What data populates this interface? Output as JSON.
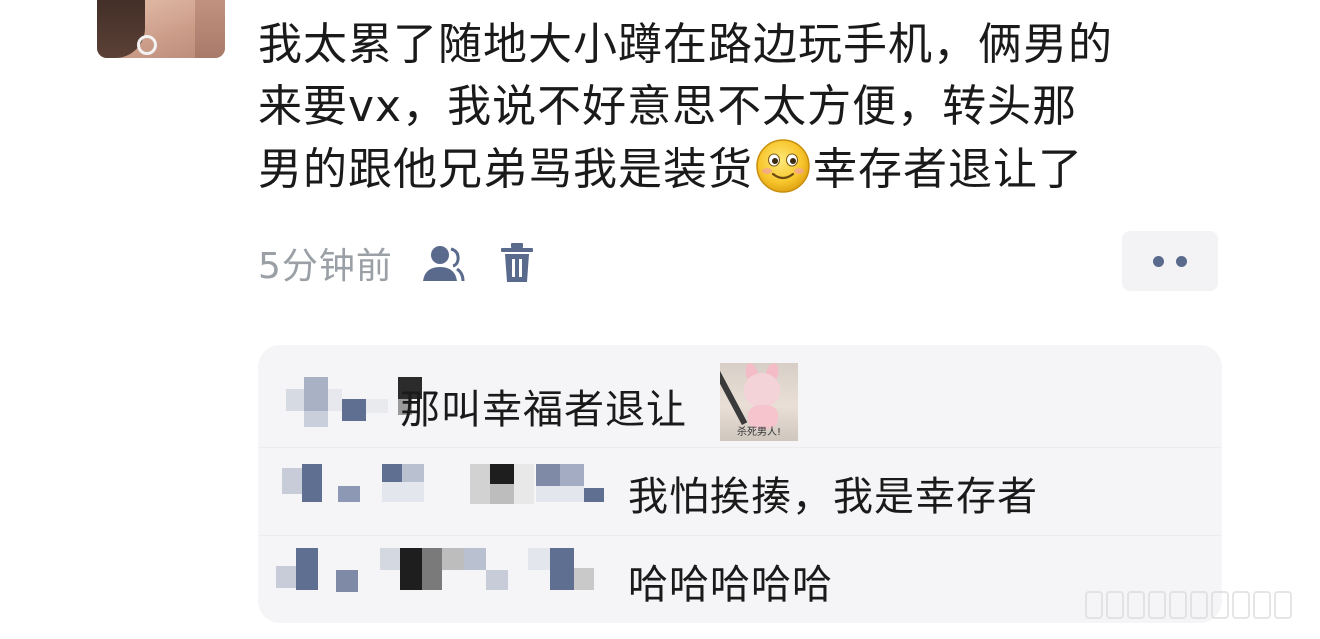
{
  "post": {
    "lines": [
      "我太累了随地大小蹲在路边玩手机，俩男的",
      "来要vx，我说不好意思不太方便，转头那",
      "男的跟他兄弟骂我是装货"
    ],
    "line3_tail": "幸存者退让了",
    "emoji": "slightly-smiling-face-emoji",
    "time": "5分钟前"
  },
  "icons": {
    "visibility": "user-icon",
    "delete": "trash-icon",
    "more": "more-dots-icon"
  },
  "comments": [
    {
      "text": "那叫幸福者退让",
      "sticker_caption": "杀死男人!"
    },
    {
      "text": "我怕挨揍，我是幸存者"
    },
    {
      "text": "哈哈哈哈哈"
    }
  ],
  "colors": {
    "accent_icon": "#5a6a8c",
    "comment_bg": "#f5f5f7",
    "meta_text": "#9aa0a6"
  }
}
